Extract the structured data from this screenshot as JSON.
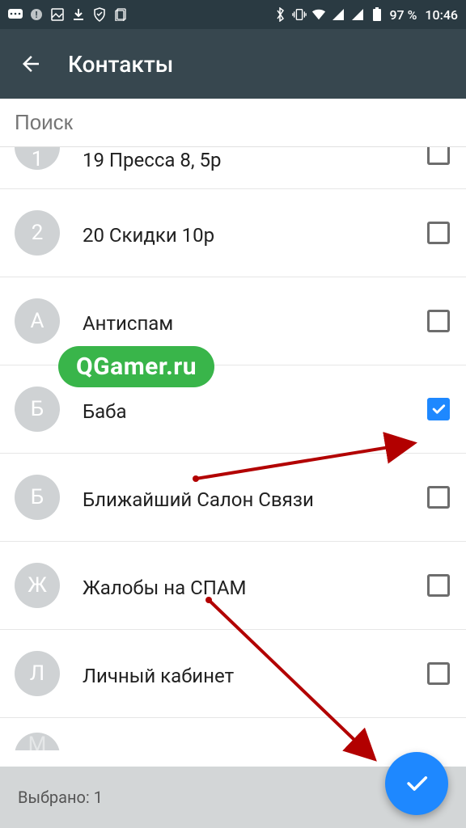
{
  "status": {
    "battery_pct": "97 %",
    "time": "10:46"
  },
  "header": {
    "title": "Контакты"
  },
  "search": {
    "placeholder": "Поиск"
  },
  "contacts": [
    {
      "avatar": "1",
      "name": "19 Пресса 8, 5p",
      "checked": false,
      "cut": "top"
    },
    {
      "avatar": "2",
      "name": "20 Скидки 10р",
      "checked": false
    },
    {
      "avatar": "А",
      "name": "Антиспам",
      "checked": false
    },
    {
      "avatar": "Б",
      "name": "Баба",
      "checked": true
    },
    {
      "avatar": "Б",
      "name": "Ближайший Салон Связи",
      "checked": false
    },
    {
      "avatar": "Ж",
      "name": "Жалобы на СПАМ",
      "checked": false
    },
    {
      "avatar": "Л",
      "name": "Личный кабинет",
      "checked": false
    },
    {
      "avatar": "М",
      "name": "",
      "checked": false,
      "cut": "bottom"
    }
  ],
  "watermark": "QGamer.ru",
  "footer": {
    "selected_label": "Выбрано:",
    "selected_count": "1"
  }
}
